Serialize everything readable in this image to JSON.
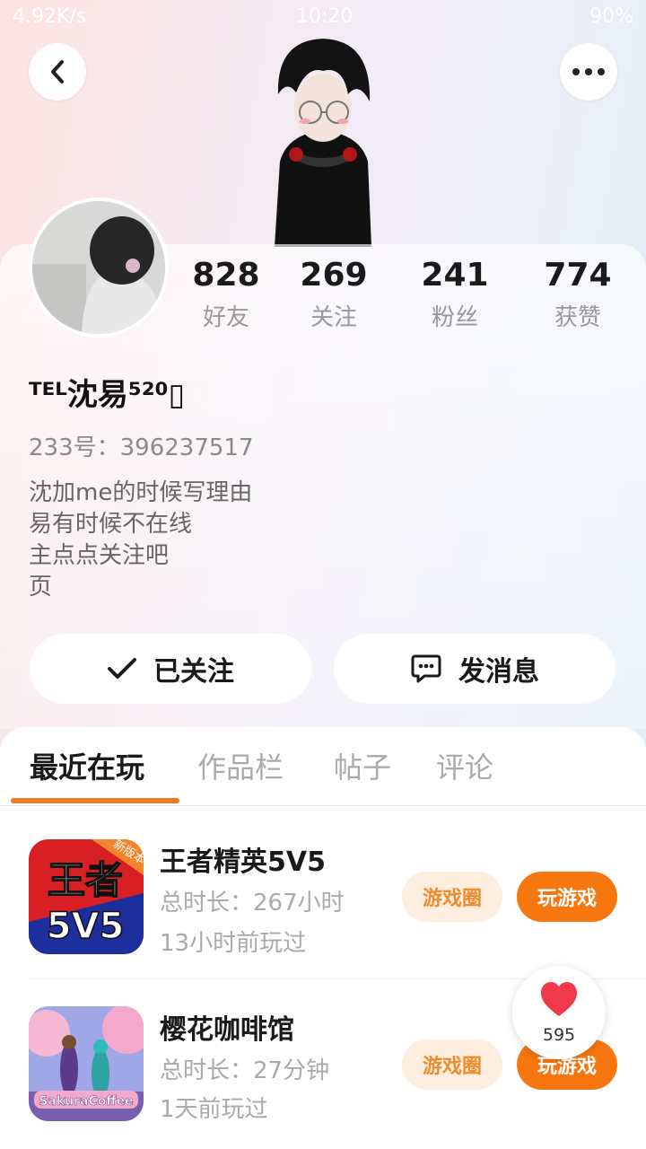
{
  "status_bar": {
    "network_speed": "4.92K/s",
    "time": "10:20",
    "battery": "90%"
  },
  "stats": [
    {
      "value": "828",
      "label": "好友"
    },
    {
      "value": "269",
      "label": "关注"
    },
    {
      "value": "241",
      "label": "粉丝"
    },
    {
      "value": "774",
      "label": "获赞"
    }
  ],
  "profile": {
    "username": "ᵀᴱᴸ沈易⁵²⁰▯",
    "account_id": "233号：396237517",
    "bio": [
      "沈加me的时候写理由",
      "易有时候不在线",
      "主点点关注吧",
      "页"
    ]
  },
  "actions": {
    "following_label": "已关注",
    "message_label": "发消息"
  },
  "tabs": [
    "最近在玩",
    "作品栏",
    "帖子",
    "评论"
  ],
  "games": [
    {
      "name": "王者精英5V5",
      "duration": "总时长：267小时",
      "last_played": "13小时前玩过",
      "icon_text": "王者\n5V5",
      "badge": "新版本",
      "circle_label": "游戏圈",
      "play_label": "玩游戏"
    },
    {
      "name": "樱花咖啡馆",
      "duration": "总时长：27分钟",
      "last_played": "1天前玩过",
      "icon_text": "SakuraCoffee",
      "circle_label": "游戏圈",
      "play_label": "玩游戏"
    }
  ],
  "floating_like": {
    "count": "595"
  },
  "colors": {
    "accent": "#f6760f",
    "accent_soft": "#fdeee0",
    "text_main": "#1a1a1a",
    "text_muted": "#999999"
  }
}
